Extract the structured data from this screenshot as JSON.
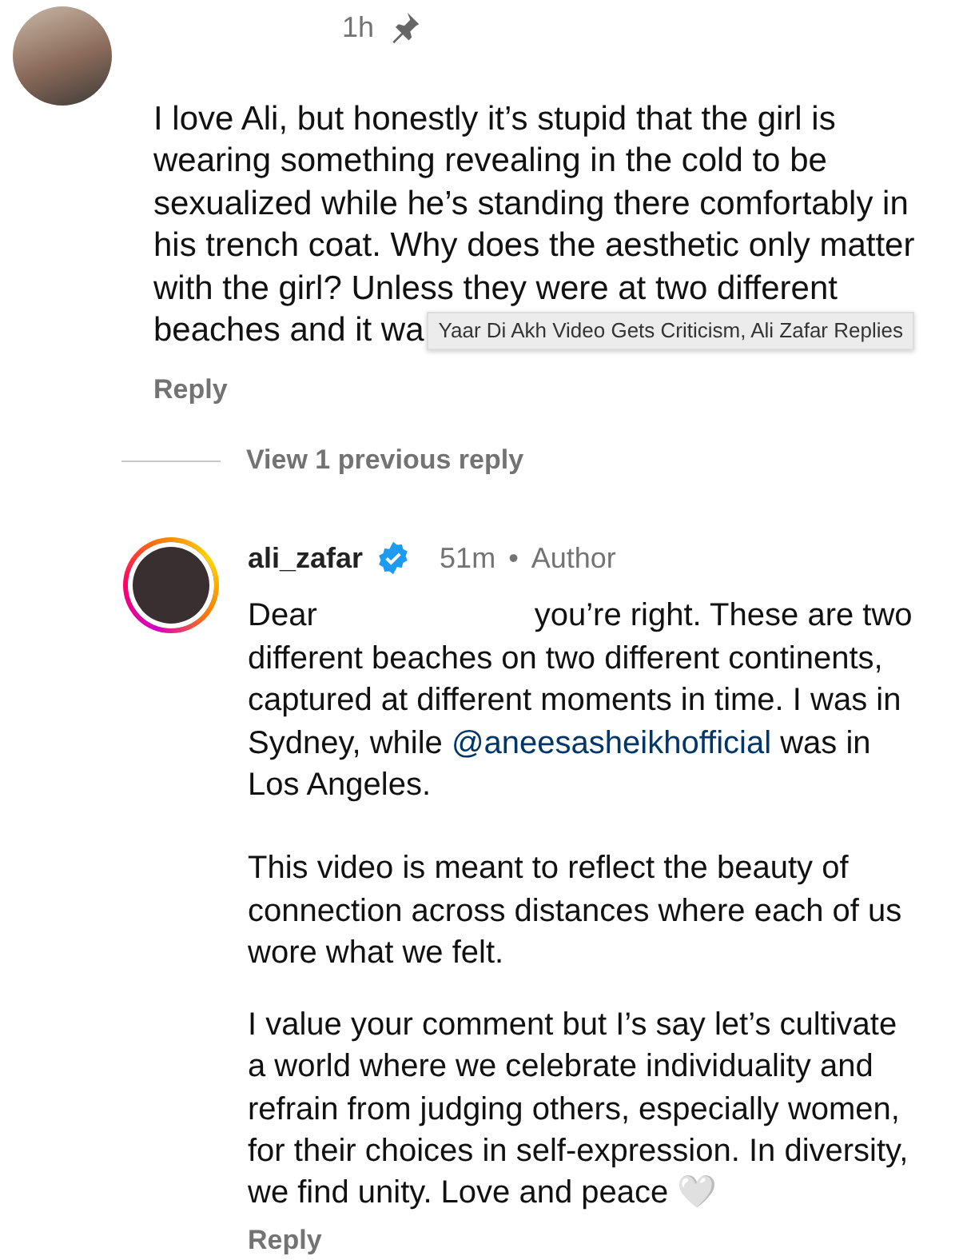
{
  "comments": [
    {
      "time": "1h",
      "pinned": true,
      "avatar_ring": false,
      "text": "I love Ali, but honestly it’s stupid that the girl is wearing something revealing in the cold to be sexualized while he’s standing there comfortably in his trench coat. Why does the aesthetic only matter with the girl? Unless they were at two different beaches and it wa",
      "tooltip": "Yaar Di Akh Video Gets Criticism, Ali Zafar Replies",
      "reply": "Reply"
    },
    {
      "view_replies": "View 1 previous reply"
    },
    {
      "username": "ali_zafar",
      "verified": true,
      "time": "51m",
      "separator": "•",
      "role": "Author",
      "avatar_ring": true,
      "greeting": "Dear",
      "text_after_name": "you’re right. These are two different beaches on two different continents, captured at different moments in time. I was in Sydney, while ",
      "mention": "@aneesasheikhofficial",
      "text_end": " was in Los Angeles.",
      "paragraphs": [
        "This video is meant to reflect the beauty of connection across distances where each of us wore what we felt.",
        "I value your comment but I’s say let’s cultivate a world where we celebrate individuality and refrain from judging others, especially women, for their choices in self-expression. In diversity, we find unity. Love and peace 🤍"
      ],
      "reply": "Reply"
    }
  ]
}
